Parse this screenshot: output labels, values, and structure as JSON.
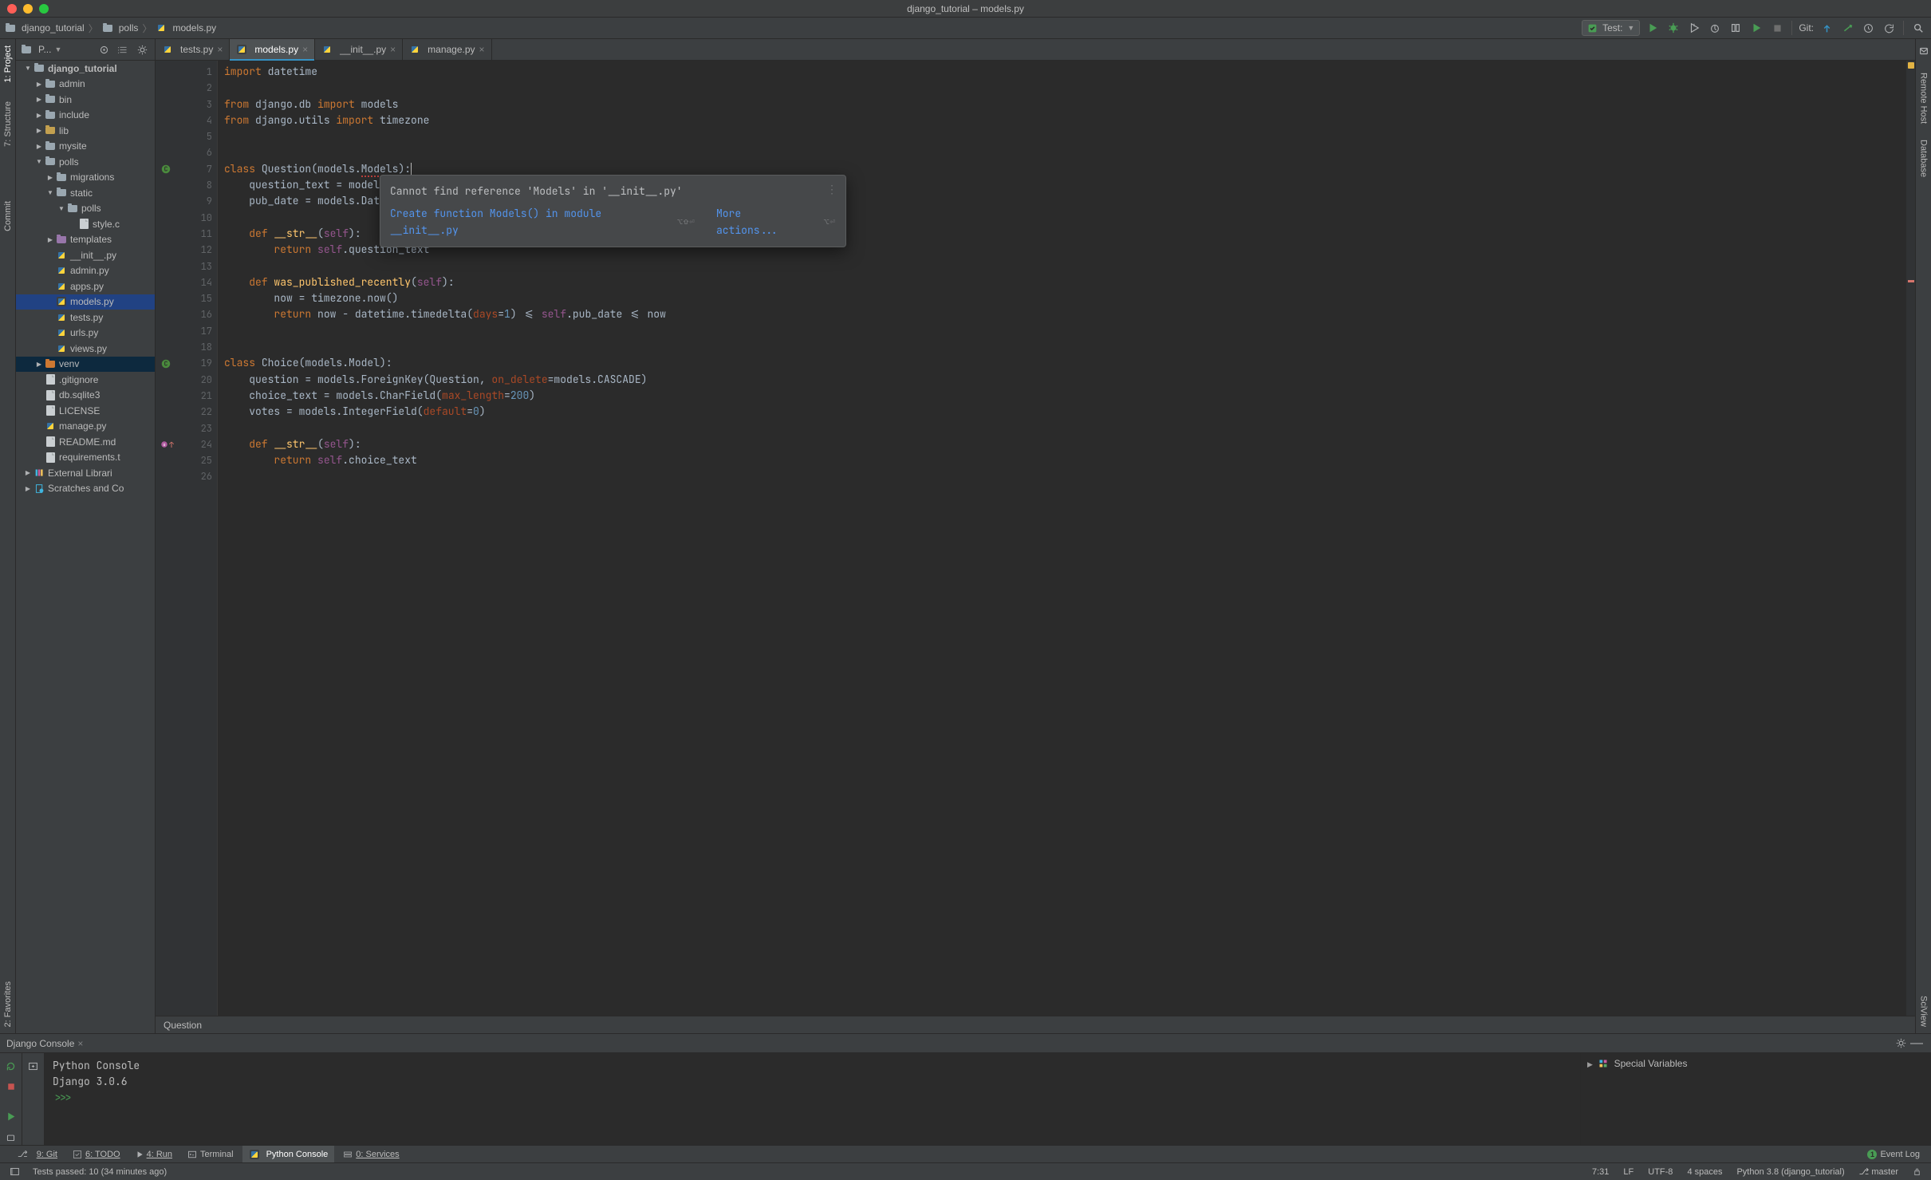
{
  "window_title": "django_tutorial – models.py",
  "breadcrumbs": [
    "django_tutorial",
    "polls",
    "models.py"
  ],
  "run_config": {
    "label": "Test:"
  },
  "git_label": "Git:",
  "left_stripe": {
    "project": "1: Project",
    "structure": "7: Structure",
    "commit": "Commit",
    "favorites": "2: Favorites"
  },
  "right_stripe": {
    "remote": "Remote Host",
    "database": "Database",
    "sciview": "SciView"
  },
  "sidebar": {
    "title": "P...",
    "tree": [
      {
        "lvl": 0,
        "ar": "d",
        "icon": "folder",
        "label": "django_tutorial",
        "bold": true
      },
      {
        "lvl": 1,
        "ar": "r",
        "icon": "folder",
        "label": "admin"
      },
      {
        "lvl": 1,
        "ar": "r",
        "icon": "folder",
        "label": "bin"
      },
      {
        "lvl": 1,
        "ar": "r",
        "icon": "folder",
        "label": "include"
      },
      {
        "lvl": 1,
        "ar": "r",
        "icon": "folder-yellow",
        "label": "lib"
      },
      {
        "lvl": 1,
        "ar": "r",
        "icon": "folder",
        "label": "mysite"
      },
      {
        "lvl": 1,
        "ar": "d",
        "icon": "folder",
        "label": "polls"
      },
      {
        "lvl": 2,
        "ar": "r",
        "icon": "folder",
        "label": "migrations"
      },
      {
        "lvl": 2,
        "ar": "d",
        "icon": "folder",
        "label": "static"
      },
      {
        "lvl": 3,
        "ar": "d",
        "icon": "folder",
        "label": "polls"
      },
      {
        "lvl": 4,
        "ar": "",
        "icon": "gfile",
        "label": "style.c"
      },
      {
        "lvl": 2,
        "ar": "r",
        "icon": "folder-purple",
        "label": "templates"
      },
      {
        "lvl": 2,
        "ar": "",
        "icon": "py",
        "label": "__init__.py"
      },
      {
        "lvl": 2,
        "ar": "",
        "icon": "py",
        "label": "admin.py"
      },
      {
        "lvl": 2,
        "ar": "",
        "icon": "py",
        "label": "apps.py"
      },
      {
        "lvl": 2,
        "ar": "",
        "icon": "py",
        "label": "models.py",
        "sel": true
      },
      {
        "lvl": 2,
        "ar": "",
        "icon": "py",
        "label": "tests.py"
      },
      {
        "lvl": 2,
        "ar": "",
        "icon": "py",
        "label": "urls.py"
      },
      {
        "lvl": 2,
        "ar": "",
        "icon": "py",
        "label": "views.py"
      },
      {
        "lvl": 1,
        "ar": "r",
        "icon": "folder-orange",
        "label": "venv",
        "hl": true
      },
      {
        "lvl": 1,
        "ar": "",
        "icon": "gfile",
        "label": ".gitignore"
      },
      {
        "lvl": 1,
        "ar": "",
        "icon": "gfile",
        "label": "db.sqlite3"
      },
      {
        "lvl": 1,
        "ar": "",
        "icon": "gfile",
        "label": "LICENSE"
      },
      {
        "lvl": 1,
        "ar": "",
        "icon": "py",
        "label": "manage.py"
      },
      {
        "lvl": 1,
        "ar": "",
        "icon": "gfile",
        "label": "README.md"
      },
      {
        "lvl": 1,
        "ar": "",
        "icon": "gfile",
        "label": "requirements.t"
      },
      {
        "lvl": 0,
        "ar": "r",
        "icon": "lib",
        "label": "External Librari"
      },
      {
        "lvl": 0,
        "ar": "r",
        "icon": "scratch",
        "label": "Scratches and Co"
      }
    ]
  },
  "tabs": [
    {
      "label": "tests.py",
      "active": false,
      "close": true
    },
    {
      "label": "models.py",
      "active": true,
      "close": true
    },
    {
      "label": "__init__.py",
      "active": false,
      "close": true
    },
    {
      "label": "manage.py",
      "active": false,
      "close": true
    }
  ],
  "editor": {
    "line_numbers": [
      1,
      2,
      3,
      4,
      5,
      6,
      7,
      8,
      9,
      10,
      11,
      12,
      13,
      14,
      15,
      16,
      17,
      18,
      19,
      20,
      21,
      22,
      23,
      24,
      25,
      26
    ],
    "breadcrumb": "Question"
  },
  "code": {
    "l1": {
      "a": "import ",
      "b": "datetime"
    },
    "l3": {
      "a": "from ",
      "b": "django.db ",
      "c": "import ",
      "d": "models"
    },
    "l4": {
      "a": "from ",
      "b": "django.utils ",
      "c": "import ",
      "d": "timezone"
    },
    "l7": {
      "a": "class ",
      "b": "Question(models.",
      "c": "Models",
      "d": "):"
    },
    "l8": "    question_text = models",
    "l9": "    pub_date = models.Dat",
    "l11": {
      "a": "    def ",
      "b": "__str__",
      "c": "(",
      "d": "self",
      "e": "):"
    },
    "l12": {
      "a": "        return ",
      "b": "self",
      "c": ".question_text"
    },
    "l14": {
      "a": "    def ",
      "b": "was_published_recently",
      "c": "(",
      "d": "self",
      "e": "):"
    },
    "l15": "        now = timezone.now()",
    "l16": {
      "a": "        return ",
      "b": "now - datetime.timedelta(",
      "c": "days",
      "d": "=",
      "e": "1",
      "f": ") <= ",
      "g": "self",
      "h": ".pub_date <= now"
    },
    "l19": {
      "a": "class ",
      "b": "Choice(models.Model):"
    },
    "l20": {
      "a": "    question = models.ForeignKey(Question",
      "b": ", ",
      "c": "on_delete",
      "d": "=models.CASCADE)"
    },
    "l21": {
      "a": "    choice_text = models.CharField(",
      "b": "max_length",
      "c": "=",
      "d": "200",
      "e": ")"
    },
    "l22": {
      "a": "    votes = models.IntegerField(",
      "b": "default",
      "c": "=",
      "d": "0",
      "e": ")"
    },
    "l24": {
      "a": "    def ",
      "b": "__str__",
      "c": "(",
      "d": "self",
      "e": "):"
    },
    "l25": {
      "a": "        return ",
      "b": "self",
      "c": ".choice_text"
    }
  },
  "intention": {
    "title": "Cannot find reference 'Models' in '__init__.py'",
    "action": "Create function Models() in module __init__.py",
    "more": "More actions...",
    "kbd1": "⌥⇧⏎",
    "kbd2": "⌥⏎"
  },
  "console": {
    "tab": "Django Console",
    "lines": [
      "Python Console",
      "Django 3.0.6",
      "",
      ">>>"
    ],
    "right_header": "Special Variables"
  },
  "bottom_tabs": {
    "git": "9: Git",
    "todo": "6: TODO",
    "run": "4: Run",
    "terminal": "Terminal",
    "pyconsole": "Python Console",
    "services": "0: Services",
    "eventlog": "Event Log",
    "event_count": "1"
  },
  "statusbar": {
    "tests": "Tests passed: 10 (34 minutes ago)",
    "pos": "7:31",
    "lf": "LF",
    "enc": "UTF-8",
    "indent": "4 spaces",
    "python": "Python 3.8 (django_tutorial)",
    "branch": "master"
  }
}
